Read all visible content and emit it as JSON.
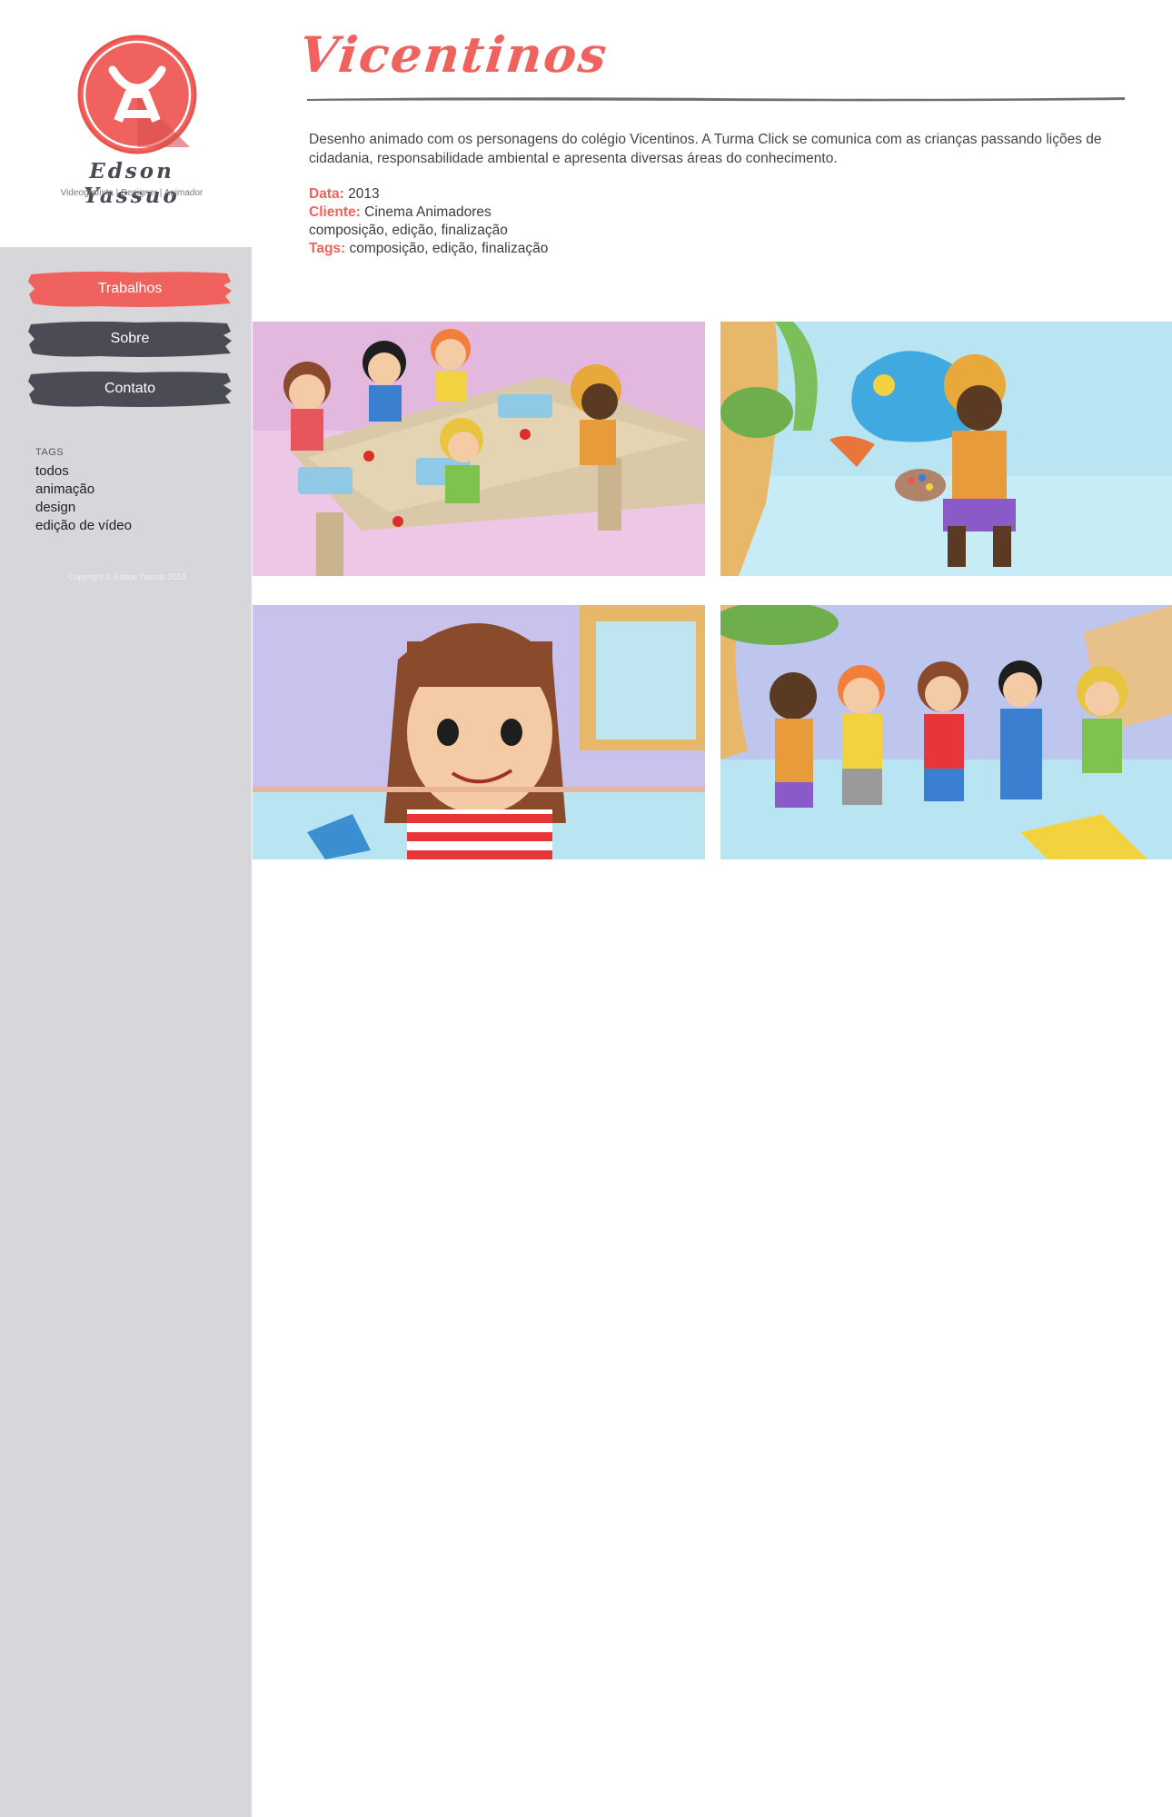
{
  "logo": {
    "name": "Edson Yassuo",
    "subtitle": "Videografista | Designer | Animador"
  },
  "nav": {
    "items": [
      {
        "label": "Trabalhos",
        "active": true
      },
      {
        "label": "Sobre",
        "active": false
      },
      {
        "label": "Contato",
        "active": false
      }
    ]
  },
  "tags": {
    "heading": "TAGS",
    "items": [
      "todos",
      "animação",
      "design",
      "edição de vídeo"
    ]
  },
  "footer": {
    "copyright": "Copyright © Edson Yassuo 2013"
  },
  "project": {
    "title": "Vicentinos",
    "description": "Desenho animado com os personagens do colégio Vicentinos. A Turma Click se comunica com as crianças passando lições de cidadania, responsabilidade ambiental e apresenta diversas áreas do conhecimento.",
    "data_label": "Data:",
    "data_value": "2013",
    "cliente_label": "Cliente:",
    "cliente_value": "Cinema Animadores",
    "services": "composição, edição, finalização",
    "tags_label": "Tags:",
    "tags_value": "composição, edição, finalização"
  },
  "colors": {
    "accent": "#f0625d",
    "nav_dark": "#4a4b55",
    "sidebar_gray": "#d6d6db"
  },
  "gallery": [
    {
      "name": "cafeteria-scene"
    },
    {
      "name": "painter-scene"
    },
    {
      "name": "girl-closeup-scene"
    },
    {
      "name": "group-hopscotch-scene"
    }
  ]
}
